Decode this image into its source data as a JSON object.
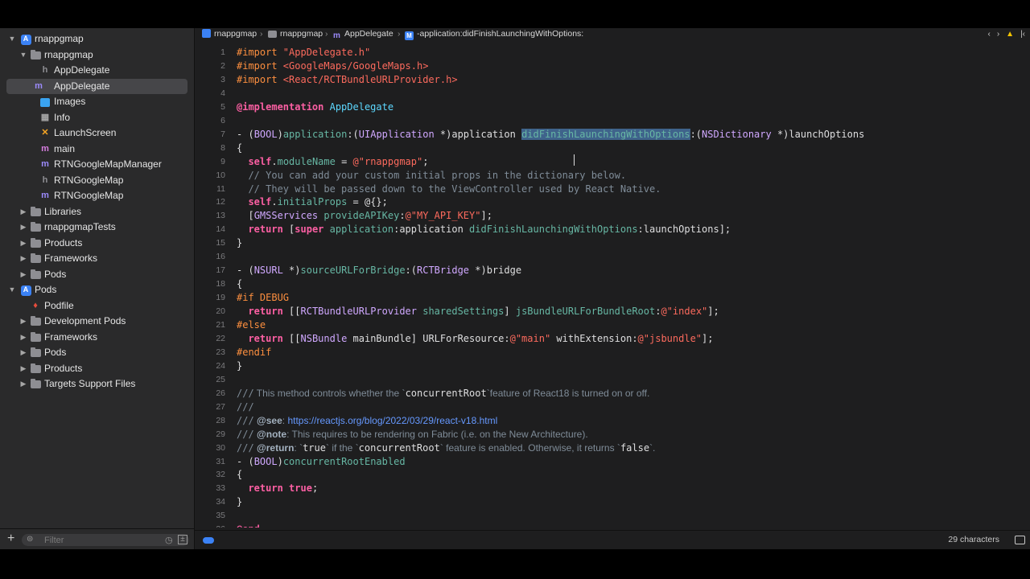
{
  "sidebar": {
    "items": [
      {
        "label": "rnappgmap",
        "icon": "app-icon",
        "depth": 0,
        "chevron": "down"
      },
      {
        "label": "rnappgmap",
        "icon": "folder-icon",
        "depth": 1,
        "chevron": "down"
      },
      {
        "label": "AppDelegate",
        "icon": "header-file-icon",
        "glyph": "h",
        "depth": 2
      },
      {
        "label": "AppDelegate",
        "icon": "objc-file-icon",
        "glyph": "m",
        "depth": 2,
        "selected": true
      },
      {
        "label": "Images",
        "icon": "image-icon",
        "depth": 2
      },
      {
        "label": "Info",
        "icon": "plist-icon",
        "depth": 2
      },
      {
        "label": "LaunchScreen",
        "icon": "storyboard-icon",
        "glyph": "✕",
        "depth": 2
      },
      {
        "label": "main",
        "icon": "source-file-icon",
        "glyph": "m",
        "depth": 2
      },
      {
        "label": "RTNGoogleMapManager",
        "icon": "objc-file-icon",
        "glyph": "m",
        "depth": 2
      },
      {
        "label": "RTNGoogleMap",
        "icon": "header-file-icon",
        "glyph": "h",
        "depth": 2
      },
      {
        "label": "RTNGoogleMap",
        "icon": "objc-file-icon",
        "glyph": "m",
        "depth": 2
      },
      {
        "label": "Libraries",
        "icon": "folder-icon",
        "depth": 1,
        "chevron": "right"
      },
      {
        "label": "rnappgmapTests",
        "icon": "folder-icon",
        "depth": 1,
        "chevron": "right"
      },
      {
        "label": "Products",
        "icon": "folder-icon",
        "depth": 1,
        "chevron": "right"
      },
      {
        "label": "Frameworks",
        "icon": "folder-icon",
        "depth": 1,
        "chevron": "right"
      },
      {
        "label": "Pods",
        "icon": "folder-icon",
        "depth": 1,
        "chevron": "right"
      },
      {
        "label": "Pods",
        "icon": "app-icon",
        "depth": 0,
        "chevron": "down"
      },
      {
        "label": "Podfile",
        "icon": "ruby-icon",
        "depth": 1
      },
      {
        "label": "Development Pods",
        "icon": "folder-icon",
        "depth": 1,
        "chevron": "right"
      },
      {
        "label": "Frameworks",
        "icon": "folder-icon",
        "depth": 1,
        "chevron": "right"
      },
      {
        "label": "Pods",
        "icon": "folder-icon",
        "depth": 1,
        "chevron": "right"
      },
      {
        "label": "Products",
        "icon": "folder-icon",
        "depth": 1,
        "chevron": "right"
      },
      {
        "label": "Targets Support Files",
        "icon": "folder-icon",
        "depth": 1,
        "chevron": "right"
      }
    ],
    "filter_placeholder": "Filter"
  },
  "jumpbar": {
    "crumbs": [
      "rnappgmap",
      "rnappgmap",
      "AppDelegate",
      "-application:didFinishLaunchingWithOptions:"
    ]
  },
  "editor": {
    "lines": [
      "#import \"AppDelegate.h\"",
      "#import <GoogleMaps/GoogleMaps.h>",
      "#import <React/RCTBundleURLProvider.h>",
      "",
      "@implementation AppDelegate",
      "",
      "- (BOOL)application:(UIApplication *)application didFinishLaunchingWithOptions:(NSDictionary *)launchOptions",
      "{",
      "  self.moduleName = @\"rnappgmap\";",
      "  // You can add your custom initial props in the dictionary below.",
      "  // They will be passed down to the ViewController used by React Native.",
      "  self.initialProps = @{};",
      "  [GMSServices provideAPIKey:@\"MY_API_KEY\"];",
      "  return [super application:application didFinishLaunchingWithOptions:launchOptions];",
      "}",
      "",
      "- (NSURL *)sourceURLForBridge:(RCTBridge *)bridge",
      "{",
      "#if DEBUG",
      "  return [[RCTBundleURLProvider sharedSettings] jsBundleURLForBundleRoot:@\"index\"];",
      "#else",
      "  return [[NSBundle mainBundle] URLForResource:@\"main\" withExtension:@\"jsbundle\"];",
      "#endif",
      "}",
      "",
      "/// This method controls whether the `concurrentRoot`feature of React18 is turned on or off.",
      "///",
      "/// @see: https://reactjs.org/blog/2022/03/29/react-v18.html",
      "/// @note: This requires to be rendering on Fabric (i.e. on the New Architecture).",
      "/// @return: `true` if the `concurrentRoot` feature is enabled. Otherwise, it returns `false`.",
      "- (BOOL)concurrentRootEnabled",
      "{",
      "  return true;",
      "}",
      "",
      "@end"
    ],
    "selected_text": "didFinishLaunchingWithOptions"
  },
  "status": {
    "char_count": "29 characters"
  }
}
